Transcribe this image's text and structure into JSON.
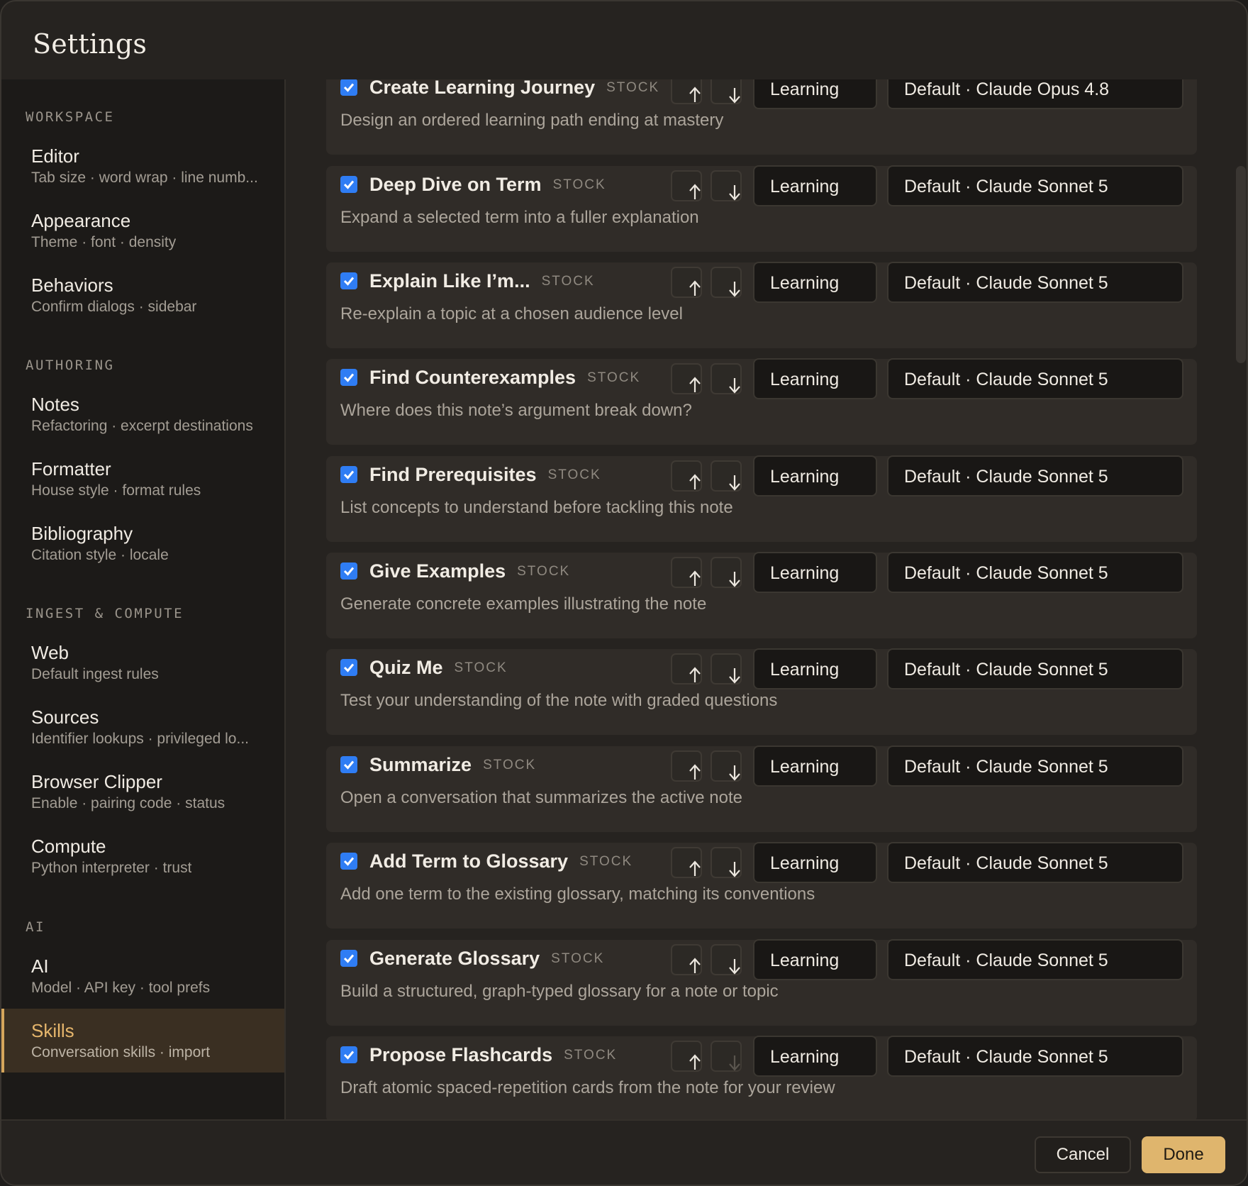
{
  "window": {
    "title": "Settings"
  },
  "sidebar": {
    "sections": [
      {
        "heading": "WORKSPACE",
        "items": [
          {
            "title": "Editor",
            "subtitle": "Tab size · word wrap · line numb..."
          },
          {
            "title": "Appearance",
            "subtitle": "Theme · font · density"
          },
          {
            "title": "Behaviors",
            "subtitle": "Confirm dialogs · sidebar"
          }
        ]
      },
      {
        "heading": "AUTHORING",
        "items": [
          {
            "title": "Notes",
            "subtitle": "Refactoring · excerpt destinations"
          },
          {
            "title": "Formatter",
            "subtitle": "House style · format rules"
          },
          {
            "title": "Bibliography",
            "subtitle": "Citation style · locale"
          }
        ]
      },
      {
        "heading": "INGEST & COMPUTE",
        "items": [
          {
            "title": "Web",
            "subtitle": "Default ingest rules"
          },
          {
            "title": "Sources",
            "subtitle": "Identifier lookups · privileged lo..."
          },
          {
            "title": "Browser Clipper",
            "subtitle": "Enable · pairing code · status"
          },
          {
            "title": "Compute",
            "subtitle": "Python interpreter · trust"
          }
        ]
      },
      {
        "heading": "AI",
        "items": [
          {
            "title": "AI",
            "subtitle": "Model · API key · tool prefs"
          },
          {
            "title": "Skills",
            "subtitle": "Conversation skills · import",
            "active": true
          }
        ]
      }
    ]
  },
  "skills": [
    {
      "name": "Create Learning Journey",
      "tag": "STOCK",
      "description": "Design an ordered learning path ending at mastery",
      "enabled": true,
      "category": "Learning",
      "model": "Default · Claude Opus 4.8"
    },
    {
      "name": "Deep Dive on Term",
      "tag": "STOCK",
      "description": "Expand a selected term into a fuller explanation",
      "enabled": true,
      "category": "Learning",
      "model": "Default · Claude Sonnet 5"
    },
    {
      "name": "Explain Like I’m...",
      "tag": "STOCK",
      "description": "Re-explain a topic at a chosen audience level",
      "enabled": true,
      "category": "Learning",
      "model": "Default · Claude Sonnet 5"
    },
    {
      "name": "Find Counterexamples",
      "tag": "STOCK",
      "description": "Where does this note’s argument break down?",
      "enabled": true,
      "category": "Learning",
      "model": "Default · Claude Sonnet 5"
    },
    {
      "name": "Find Prerequisites",
      "tag": "STOCK",
      "description": "List concepts to understand before tackling this note",
      "enabled": true,
      "category": "Learning",
      "model": "Default · Claude Sonnet 5"
    },
    {
      "name": "Give Examples",
      "tag": "STOCK",
      "description": "Generate concrete examples illustrating the note",
      "enabled": true,
      "category": "Learning",
      "model": "Default · Claude Sonnet 5"
    },
    {
      "name": "Quiz Me",
      "tag": "STOCK",
      "description": "Test your understanding of the note with graded questions",
      "enabled": true,
      "category": "Learning",
      "model": "Default · Claude Sonnet 5"
    },
    {
      "name": "Summarize",
      "tag": "STOCK",
      "description": "Open a conversation that summarizes the active note",
      "enabled": true,
      "category": "Learning",
      "model": "Default · Claude Sonnet 5"
    },
    {
      "name": "Add Term to Glossary",
      "tag": "STOCK",
      "description": "Add one term to the existing glossary, matching its conventions",
      "enabled": true,
      "category": "Learning",
      "model": "Default · Claude Sonnet 5"
    },
    {
      "name": "Generate Glossary",
      "tag": "STOCK",
      "description": "Build a structured, graph-typed glossary for a note or topic",
      "enabled": true,
      "category": "Learning",
      "model": "Default · Claude Sonnet 5"
    },
    {
      "name": "Propose Flashcards",
      "tag": "STOCK",
      "description": "Draft atomic spaced-repetition cards from the note for your review",
      "enabled": true,
      "category": "Learning",
      "model": "Default · Claude Sonnet 5",
      "move_down_disabled": true
    }
  ],
  "footer": {
    "cancel_label": "Cancel",
    "done_label": "Done"
  },
  "colors": {
    "accent": "#dfb56d",
    "checkbox": "#2f7df4",
    "active_nav": "#e6b66c"
  },
  "icons": {
    "move_up": "arrow-up-icon",
    "move_down": "arrow-down-icon",
    "dropdown": "chevron-down-icon",
    "checkbox": "check-icon"
  }
}
